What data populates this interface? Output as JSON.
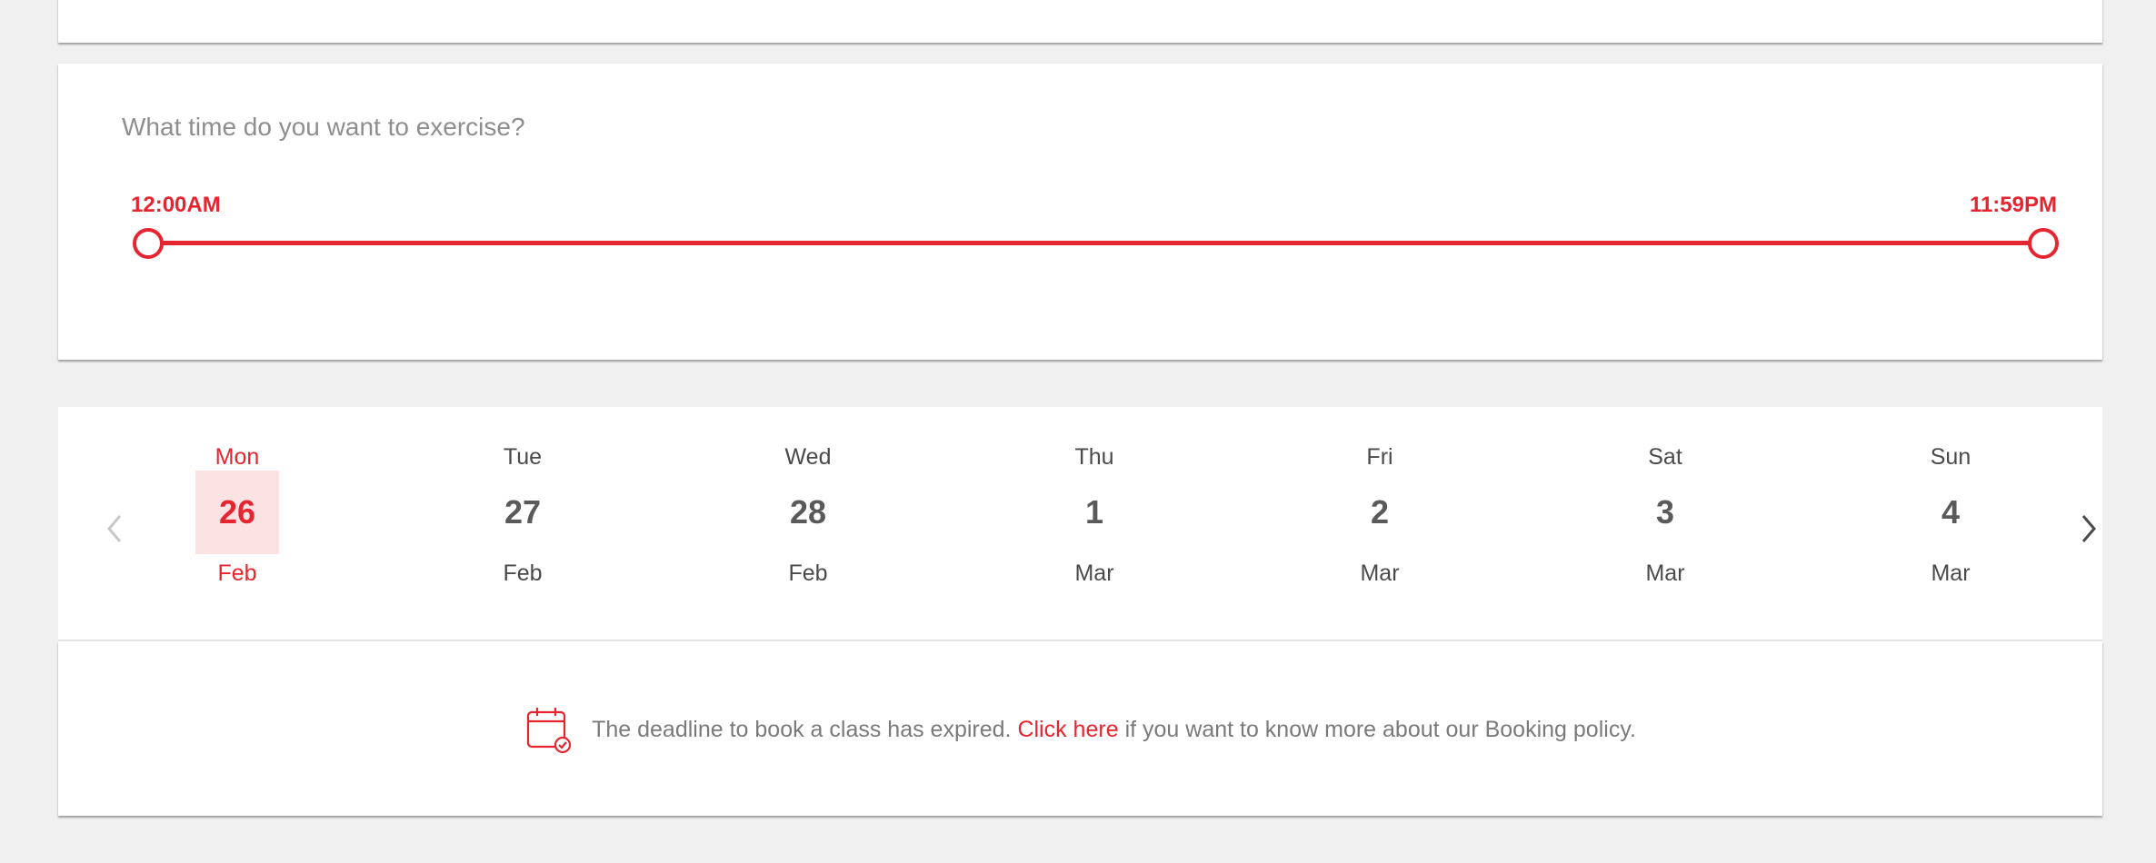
{
  "time_filter": {
    "question": "What time do you want to exercise?",
    "start_label": "12:00AM",
    "end_label": "11:59PM",
    "range_selected_fraction": [
      0,
      1
    ]
  },
  "date_picker": {
    "days": [
      {
        "dow": "Mon",
        "num": "26",
        "month": "Feb",
        "selected": true
      },
      {
        "dow": "Tue",
        "num": "27",
        "month": "Feb",
        "selected": false
      },
      {
        "dow": "Wed",
        "num": "28",
        "month": "Feb",
        "selected": false
      },
      {
        "dow": "Thu",
        "num": "1",
        "month": "Mar",
        "selected": false
      },
      {
        "dow": "Fri",
        "num": "2",
        "month": "Mar",
        "selected": false
      },
      {
        "dow": "Sat",
        "num": "3",
        "month": "Mar",
        "selected": false
      },
      {
        "dow": "Sun",
        "num": "4",
        "month": "Mar",
        "selected": false
      }
    ],
    "prev_icon": "chevron-left-icon",
    "next_icon": "chevron-right-icon"
  },
  "notice": {
    "icon": "calendar-check-icon",
    "text_before": "The deadline to book a class has expired.",
    "link_text": "Click here",
    "text_after": "if you want to know more about our Booking policy."
  },
  "colors": {
    "accent": "#e5252f",
    "selected_bg": "#fbe3e4",
    "page_bg": "#f0f0f0"
  }
}
